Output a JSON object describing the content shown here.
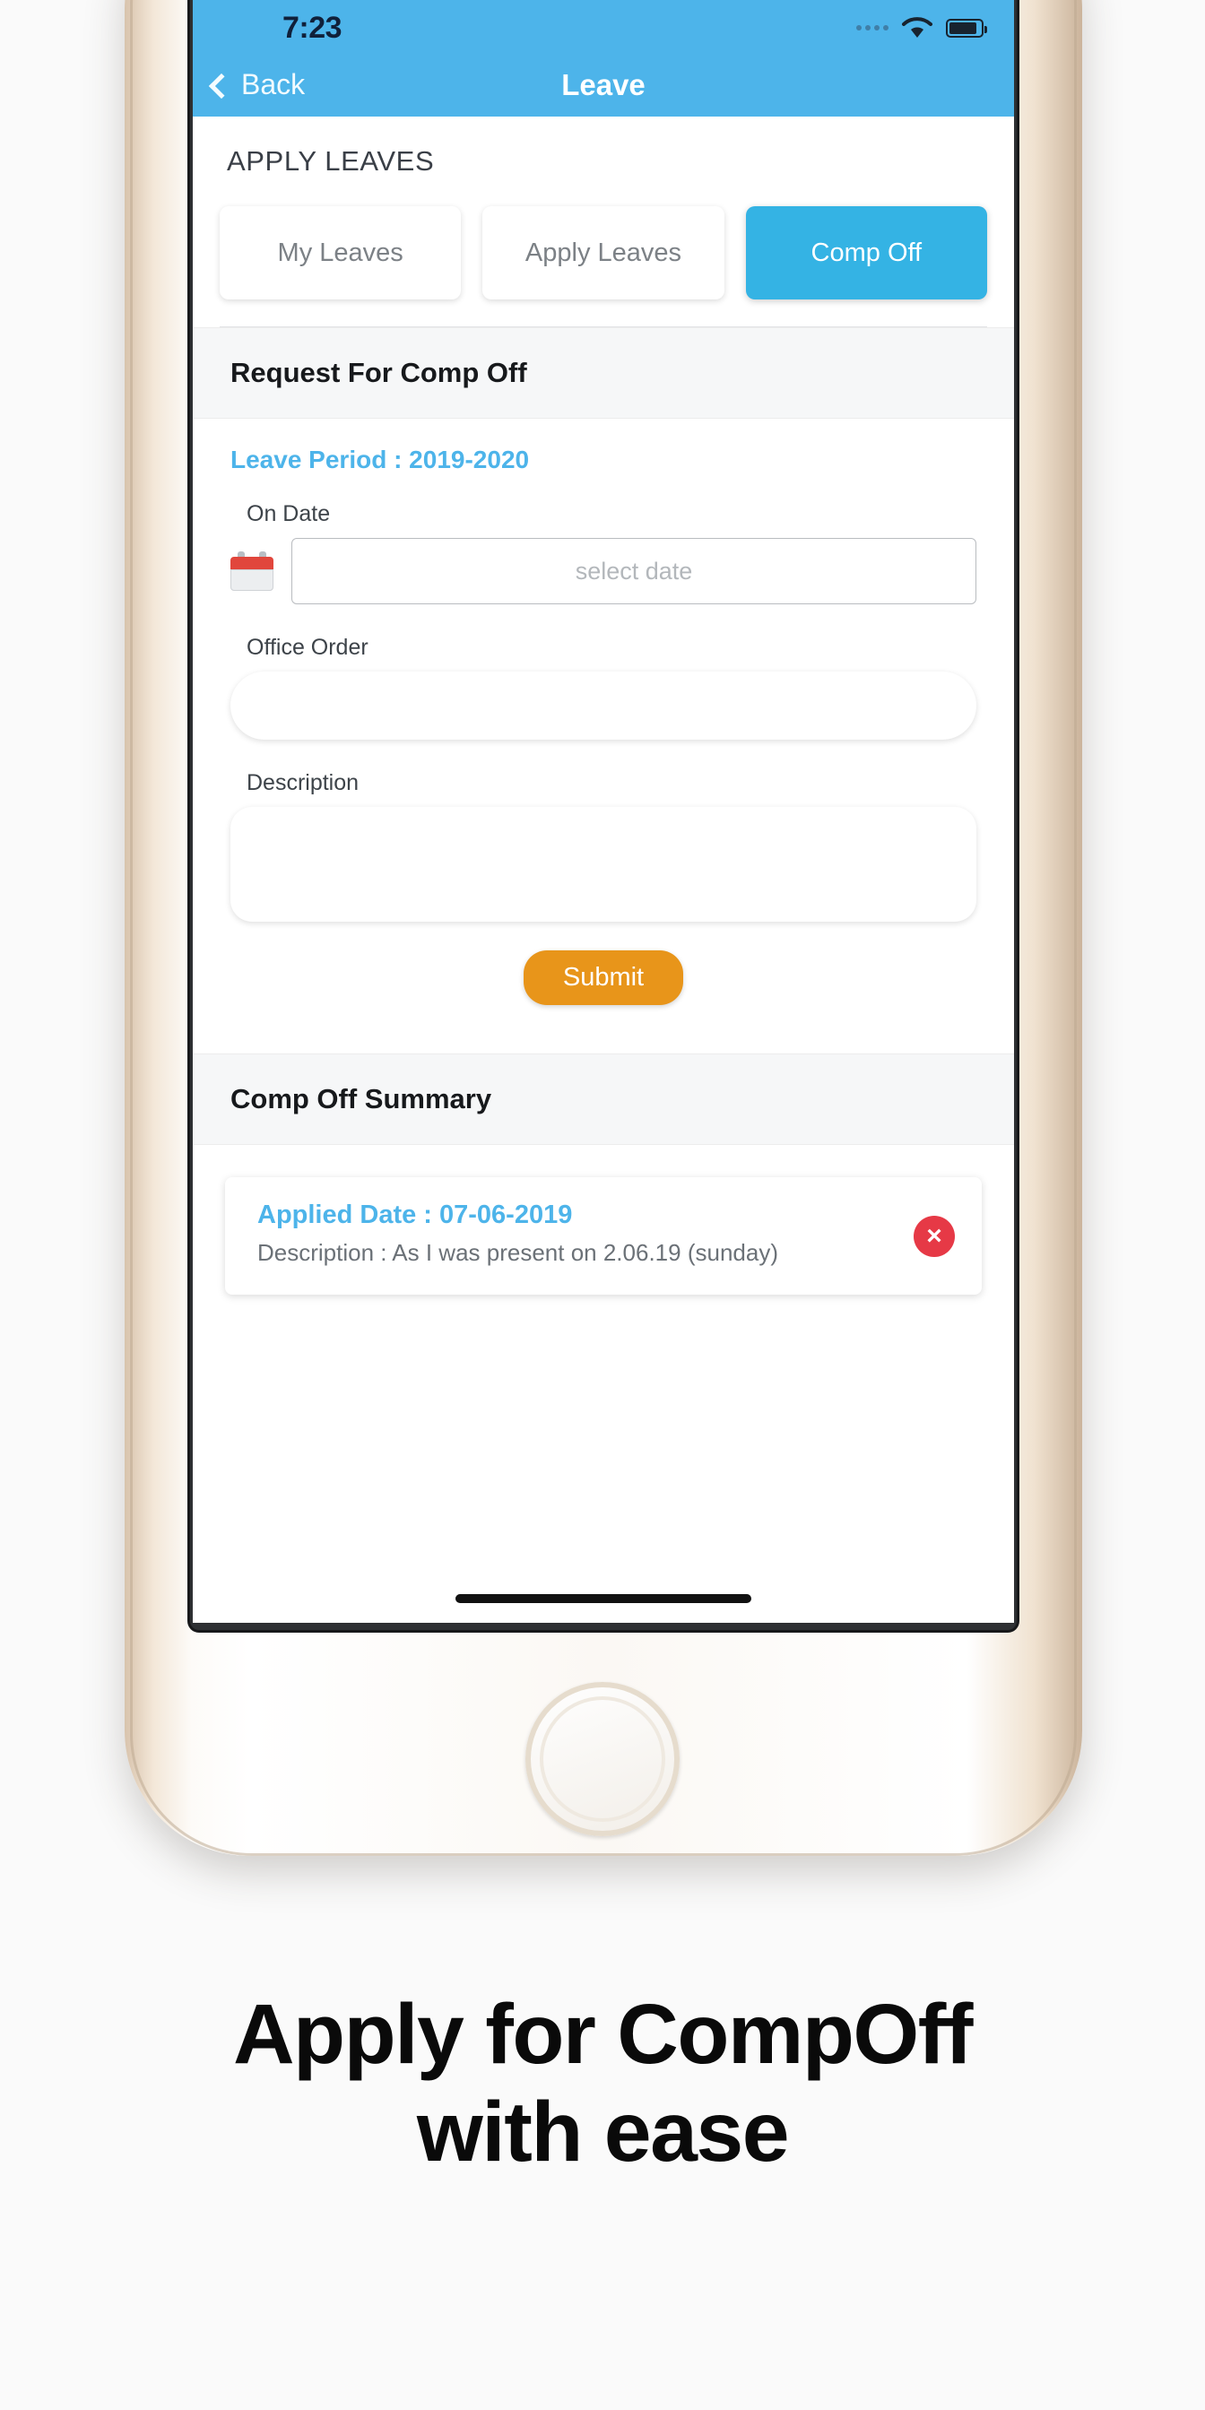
{
  "status_bar": {
    "time": "7:23",
    "icons": [
      "signal-dots-icon",
      "wifi-icon",
      "battery-charging-icon"
    ]
  },
  "nav": {
    "back_label": "Back",
    "back_icon": "chevron-left-icon",
    "title": "Leave"
  },
  "page_heading": "APPLY LEAVES",
  "tabs": [
    {
      "label": "My Leaves",
      "active": false
    },
    {
      "label": "Apply Leaves",
      "active": false
    },
    {
      "label": "Comp Off",
      "active": true
    }
  ],
  "request_section": {
    "header": "Request For Comp Off",
    "leave_period": "Leave Period : 2019-2020",
    "on_date_label": "On Date",
    "calendar_icon": "calendar-icon",
    "date_placeholder": "select date",
    "date_value": "",
    "office_order_label": "Office Order",
    "office_order_value": "",
    "description_label": "Description",
    "description_value": "",
    "submit_label": "Submit"
  },
  "summary_section": {
    "header": "Comp Off Summary",
    "items": [
      {
        "applied_date": "Applied Date : 07-06-2019",
        "description": "Description : As I was present on 2.06.19 (sunday)",
        "delete_icon": "delete-circle-icon",
        "delete_glyph": "×"
      }
    ]
  },
  "caption": {
    "line1": "Apply for CompOff",
    "line2": "with ease"
  },
  "colors": {
    "accent_blue": "#4db4ea",
    "tab_active": "#34b3e4",
    "submit_orange": "#e8951a",
    "delete_red": "#e63946",
    "section_bg": "#f6f7f8"
  }
}
